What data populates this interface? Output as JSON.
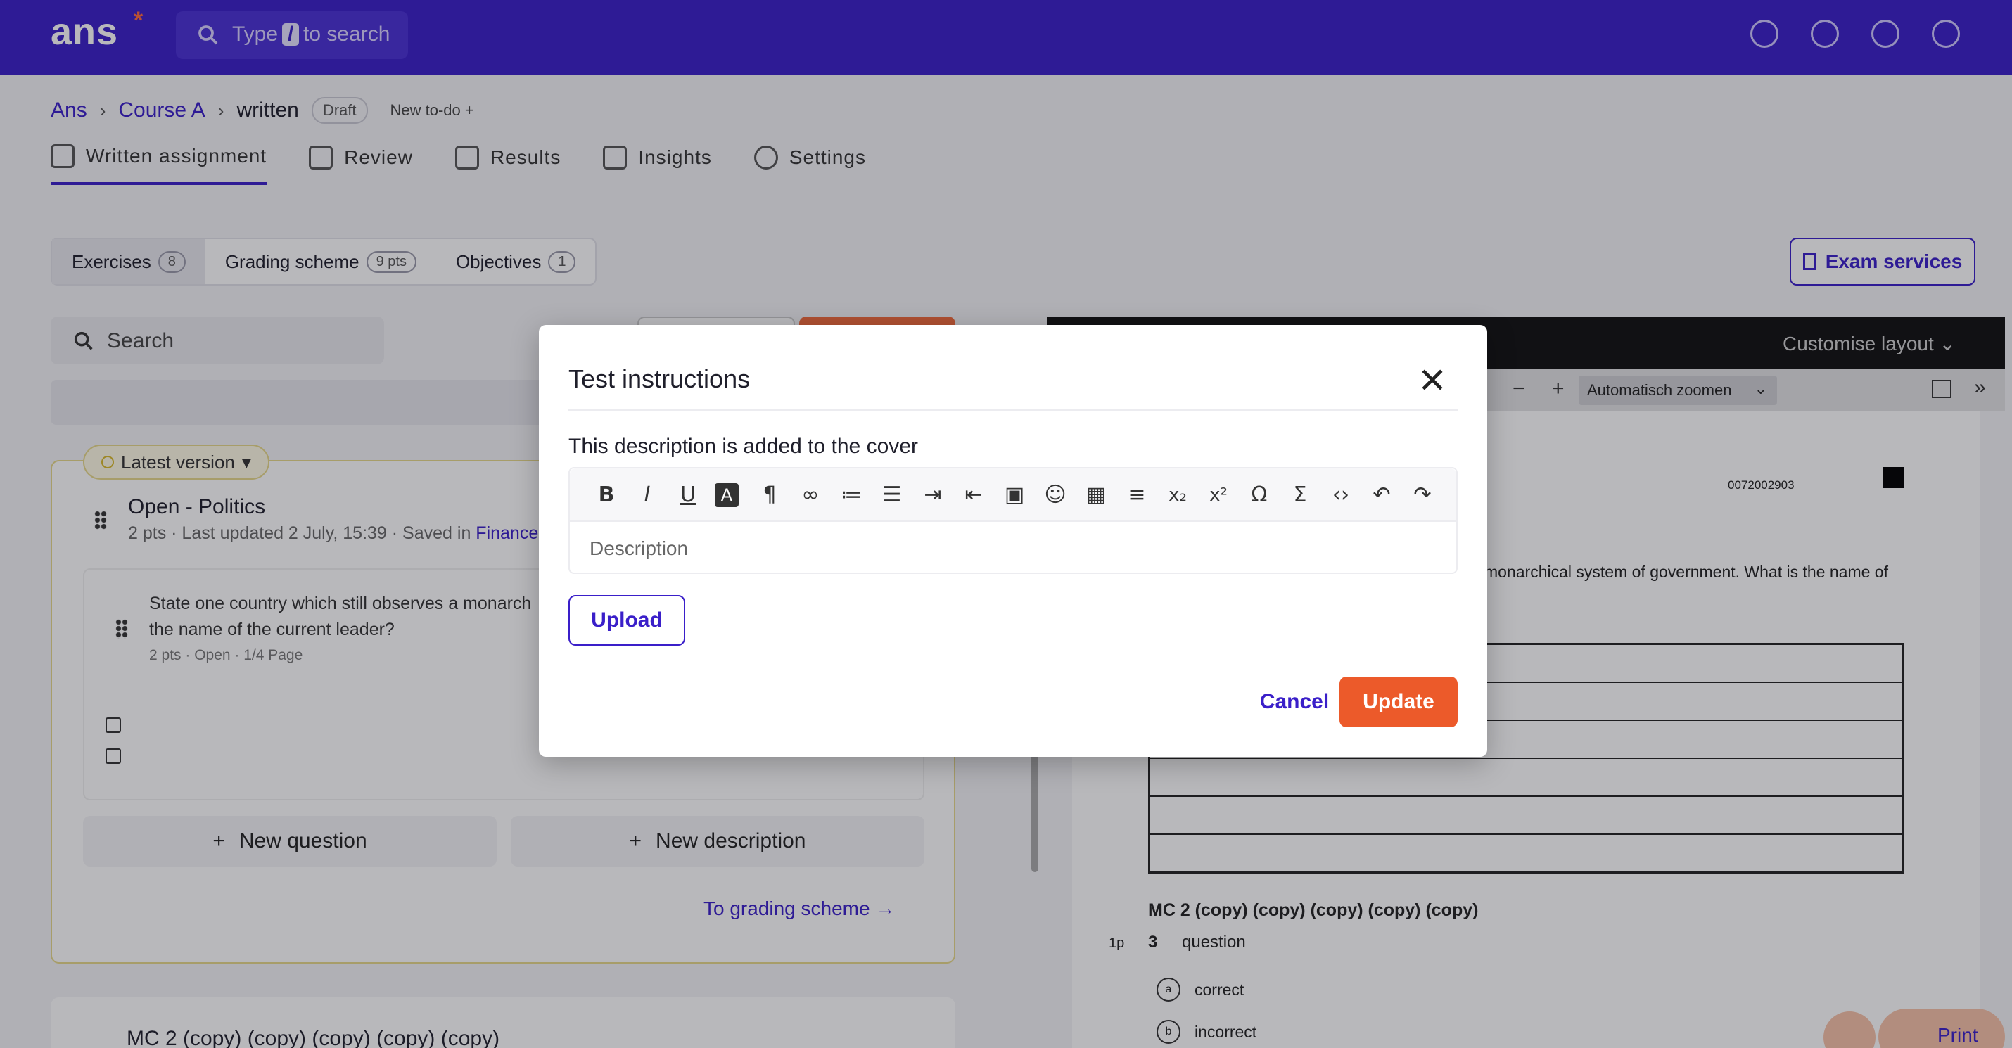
{
  "app": {
    "logo": "ans",
    "logo_mark": "*"
  },
  "search": {
    "prefix": "Type",
    "key": "/",
    "suffix": "to search"
  },
  "breadcrumb": {
    "root": "Ans",
    "course": "Course A",
    "current": "written",
    "status": "Draft",
    "new_todo": "New to-do"
  },
  "tabs": [
    {
      "label": "Written assignment",
      "icon": "layout-icon"
    },
    {
      "label": "Review",
      "icon": "review-icon"
    },
    {
      "label": "Results",
      "icon": "shield-check-icon"
    },
    {
      "label": "Insights",
      "icon": "chart-icon"
    },
    {
      "label": "Settings",
      "icon": "gear-icon"
    }
  ],
  "segments": [
    {
      "label": "Exercises",
      "count": "8"
    },
    {
      "label": "Grading scheme",
      "count": "9 pts"
    },
    {
      "label": "Objectives",
      "count": "1"
    }
  ],
  "exam_services": "Exam services",
  "left": {
    "search_placeholder": "Search",
    "version": "Latest version",
    "question_title": "Open - Politics",
    "question_meta": "2 pts · Last updated 2 July, 15:39 · Saved in",
    "question_meta_link": "Finance",
    "question_text": "State one country which still observes a monarch the name of the current leader?",
    "question_small": "2 pts · Open · 1/4 Page",
    "new_question": "New question",
    "new_description": "New description",
    "to_grading": "To grading scheme",
    "next_title": "MC 2 (copy) (copy) (copy) (copy) (copy)"
  },
  "preview": {
    "customise": "Customise layout",
    "zoom": "Automatisch zoomen",
    "doc_number": "0072002903",
    "question_text": "monarchical system of government. What is the name of",
    "mc_title": "MC 2 (copy) (copy) (copy) (copy) (copy)",
    "mc_points": "1p",
    "mc_number": "3",
    "mc_question": "question",
    "options": [
      {
        "letter": "a",
        "text": "correct"
      },
      {
        "letter": "b",
        "text": "incorrect"
      }
    ],
    "print": "Print"
  },
  "modal": {
    "title": "Test instructions",
    "label": "This description is added to the cover",
    "placeholder": "Description",
    "upload": "Upload",
    "cancel": "Cancel",
    "update": "Update",
    "toolbar": [
      "bold",
      "italic",
      "underline",
      "text-color",
      "paragraph",
      "link",
      "ordered-list",
      "bullet-list",
      "indent",
      "outdent",
      "image",
      "emoji",
      "table",
      "align",
      "subscript",
      "superscript",
      "special-char",
      "formula",
      "code",
      "undo",
      "redo"
    ]
  },
  "colors": {
    "brand": "#3a1fc9",
    "accent": "#ec5a2a"
  }
}
